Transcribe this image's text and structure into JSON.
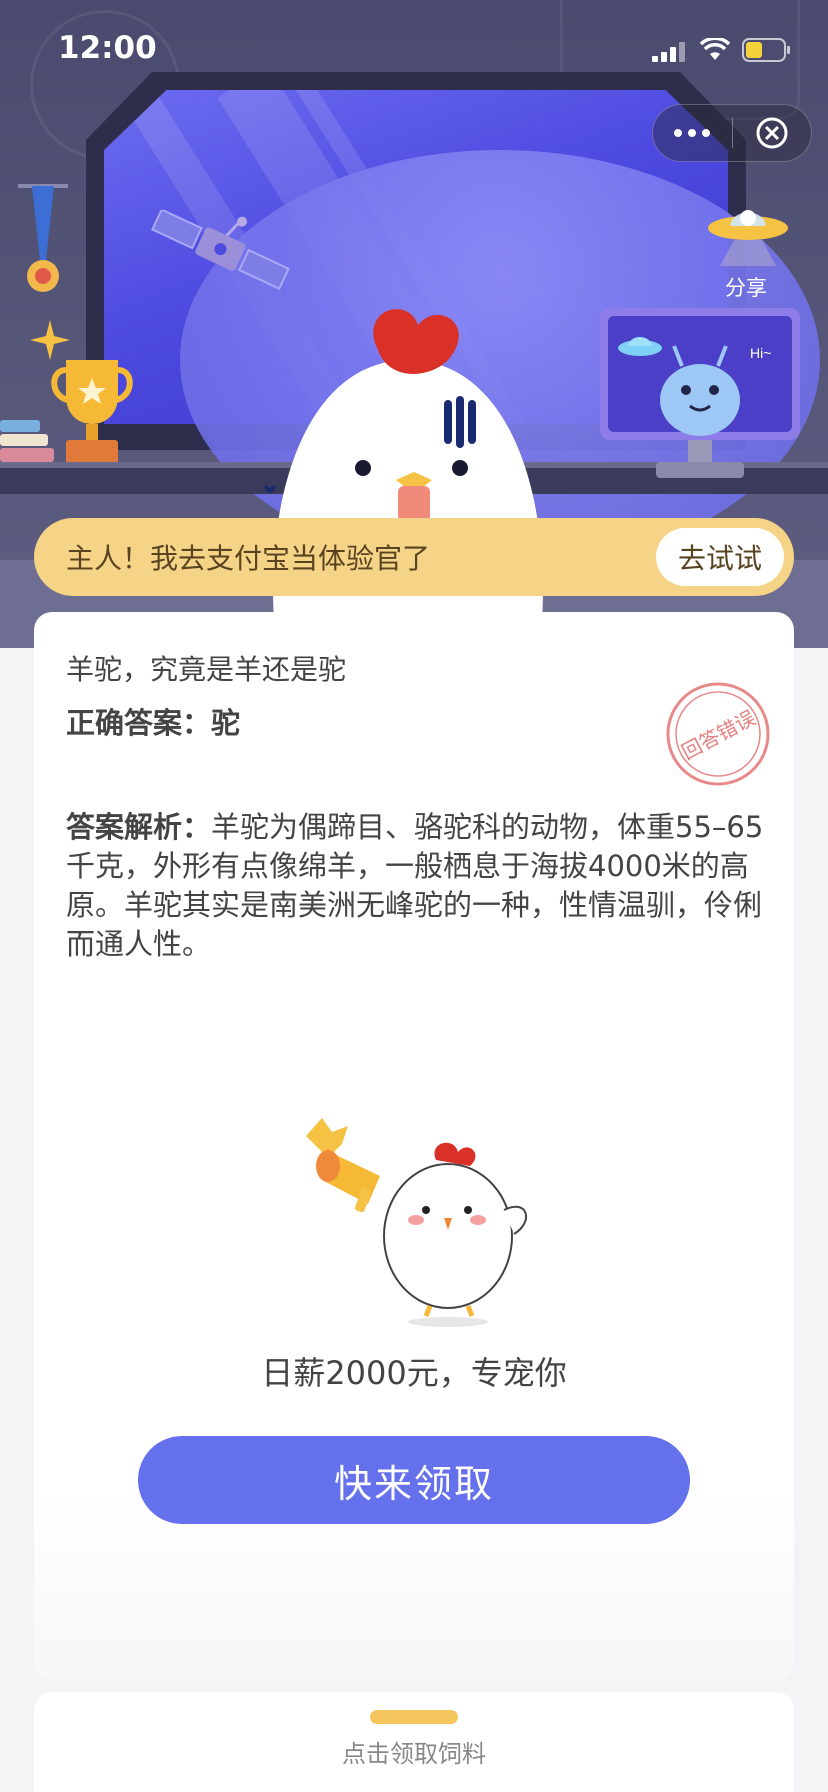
{
  "status_bar": {
    "time": "12:00"
  },
  "share": {
    "label": "分享"
  },
  "banner": {
    "text": "主人！我去支付宝当体验官了",
    "button": "去试试"
  },
  "quiz": {
    "question": "羊驼，究竟是羊还是驼",
    "answer_label": "正确答案：",
    "answer_value": "驼",
    "stamp_text": "回答错误",
    "analysis_label": "答案解析：",
    "analysis_text": "羊驼为偶蹄目、骆驼科的动物，体重55–65千克，外形有点像绵羊，一般栖息于海拔4000米的高原。羊驼其实是南美洲无峰驼的一种，性情温驯，伶俐而通人性。"
  },
  "promo": {
    "text": "日薪2000元，专宠你",
    "button": "快来领取"
  },
  "bottom": {
    "label": "点击领取饲料"
  },
  "monitor": {
    "greeting": "Hi~"
  },
  "colors": {
    "banner": "#f5d488",
    "button": "#6570ec",
    "stamp": "#e26b6b",
    "handle": "#f5c55e"
  }
}
